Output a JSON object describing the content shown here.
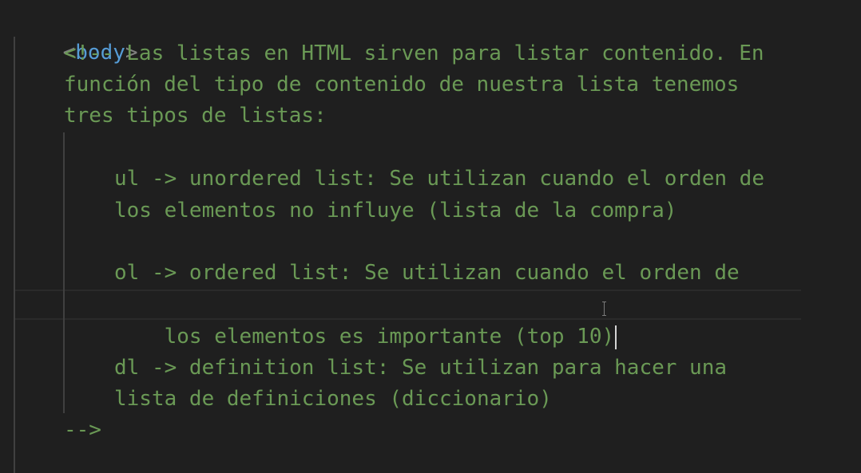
{
  "editor": {
    "tag": {
      "open_bracket": "<",
      "name": "body",
      "close_bracket": ">"
    },
    "lines": [
      "<!-- Las listas en HTML sirven para listar contenido. En",
      "función del tipo de contenido de nuestra lista tenemos",
      "tres tipos de listas:",
      "ul -> unordered list: Se utilizan cuando el orden de",
      "los elementos no influye (lista de la compra)",
      "ol -> ordered list: Se utilizan cuando el orden de",
      "los elementos es importante (top 10)",
      "dl -> definition list: Se utilizan para hacer una",
      "lista de definiciones (diccionario)",
      "-->"
    ],
    "colors": {
      "background": "#1f1f1f",
      "comment": "#6a9955",
      "tag_name": "#569cd6",
      "tag_bracket": "#808080",
      "indent_guide": "#404040"
    }
  }
}
